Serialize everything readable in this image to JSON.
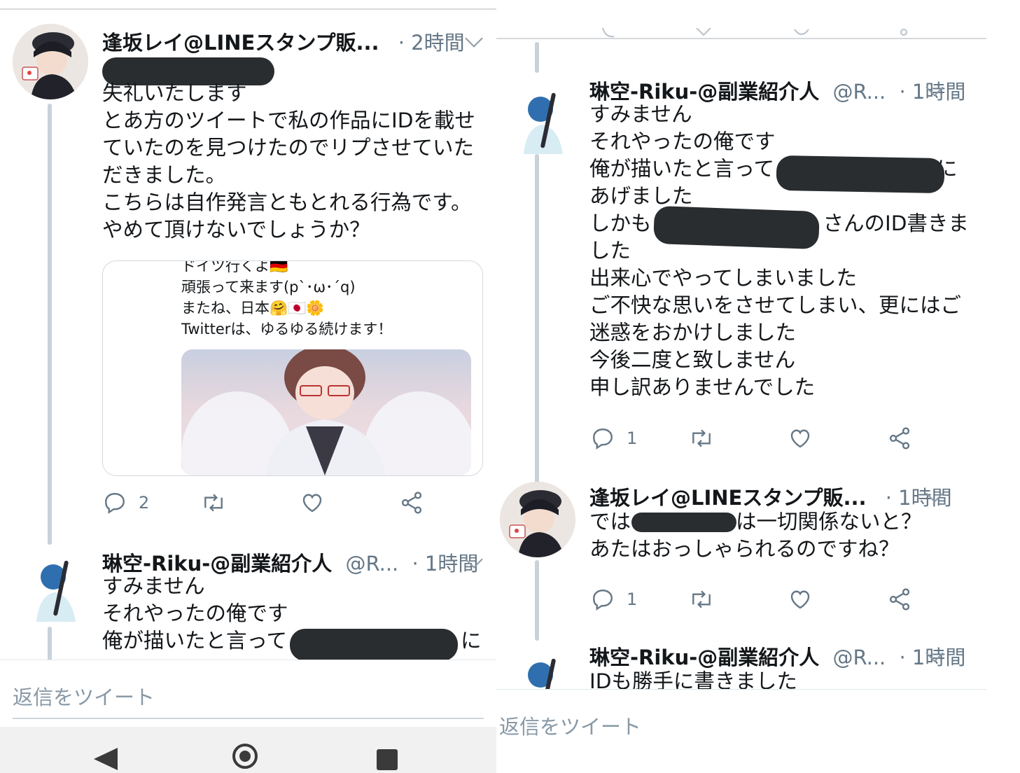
{
  "left": {
    "tweet1": {
      "name": "逢坂レイ@LINEスタンプ販...",
      "time": "· 2時間",
      "text": "失礼いたします\nとあ方のツイートで私の作品にIDを載せ\nていたのを見つけたのでリプさせていた\nだきました。\nこちらは自作発言ともとれる行為です。\nやめて頂けないでしょうか？",
      "quote_text": "ドイツ行くよ🇩🇪\n頑張って来ます(p`･ω･´q)\nまたね、日本🤗🇯🇵🌼\nTwitterは、ゆるゆる続けます！",
      "reply_count": "2"
    },
    "tweet2": {
      "name": "琳空-Riku-@副業紹介人",
      "handle": "@R...",
      "time": "· 1時間",
      "text": "すみません\nそれやったの俺です\n俺が描いたと言って",
      "text_suffix": "に"
    },
    "reply_placeholder": "返信をツイート"
  },
  "right": {
    "tweet1": {
      "name": "琳空-Riku-@副業紹介人",
      "handle": "@R...",
      "time": "· 1時間",
      "line1": "すみません",
      "line2": "それやったの俺です",
      "line3a": "俺が描いたと言って",
      "line3b": "に",
      "line4": "あげました",
      "line5a": "しかも",
      "line5b": "さんのID書きま",
      "line6": "した",
      "line7": "出来心でやってしまいました",
      "line8": "ご不快な思いをさせてしまい、更にはご",
      "line9": "迷惑をおかけしました",
      "line10": "今後二度と致しません",
      "line11": "申し訳ありませんでした",
      "reply_count": "1"
    },
    "tweet2": {
      "name": "逢坂レイ@LINEスタンプ販...",
      "time": "· 1時間",
      "line1a": "では",
      "line1b": "は一切関係ないと？",
      "line2": "あたはおっしゃられるのですね？",
      "reply_count": "1"
    },
    "tweet3": {
      "name": "琳空-Riku-@副業紹介人",
      "handle": "@R...",
      "time": "· 1時間",
      "text": "IDも勝手に書きました"
    },
    "reply_placeholder": "返信をツイート"
  },
  "colors": {
    "text": "#14171a",
    "secondary": "#657786",
    "thread_line": "#c9d1d9",
    "redaction": "#2a2d30"
  },
  "icons": [
    "reply-icon",
    "retweet-icon",
    "like-icon",
    "share-icon",
    "chevron-down-icon",
    "back-nav-icon",
    "home-nav-icon",
    "recents-nav-icon"
  ]
}
